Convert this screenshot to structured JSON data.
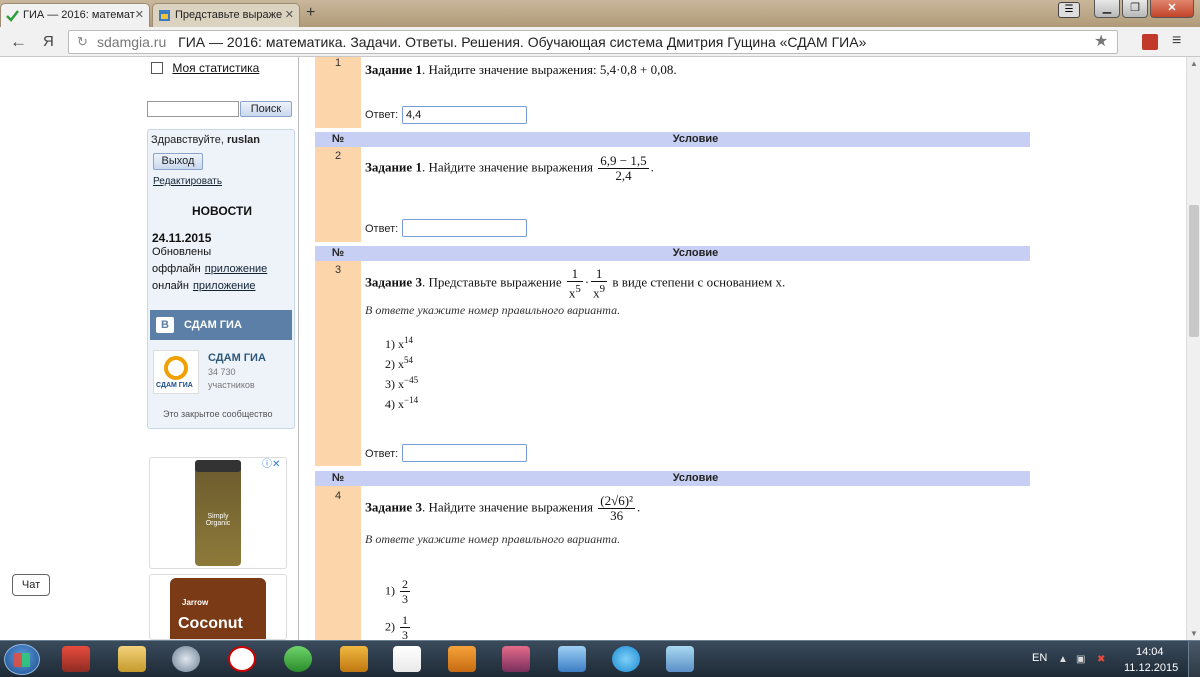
{
  "browser": {
    "tabs": [
      {
        "label": "ГИА — 2016: математ",
        "active": true
      },
      {
        "label": "Представьте выраже",
        "active": false
      }
    ],
    "newtab": "+",
    "back": "←",
    "ya_button": "Я",
    "reload": "↻",
    "domain": "sdamgia.ru",
    "page_title": "ГИА — 2016: математика. Задачи. Ответы. Решения. Обучающая система Дмитрия Гущина «СДАМ ГИА»",
    "star": "★",
    "menu": "≡"
  },
  "sidebar": {
    "stats_link": "Моя статистика",
    "search_button": "Поиск",
    "greeting": "Здравствуйте, ",
    "username": "ruslan",
    "logout_button": "Выход",
    "edit_link": "Редактировать",
    "news_title": "НОВОСТИ",
    "news_date": "24.11.2015",
    "news_line1": "Обновлены",
    "news_line2_prefix": "оффлайн",
    "news_line2_link": "приложение",
    "news_line3_prefix": "онлайн",
    "news_line3_link": "приложение",
    "vk_logo": "В",
    "vk_header": "СДАМ ГИА",
    "vk_group_name": "СДАМ ГИА",
    "vk_group_caption": "СДАМ ГИА",
    "vk_member_count": "34 730",
    "vk_members_label": "участников",
    "vk_closed": "Это закрытое сообщество",
    "ad1_label": "Simply Organic",
    "ad2_brand": "Jarrow",
    "ad2_name": "Coconut",
    "ad_badge": "ⓘ✕",
    "chat_button": "Чат"
  },
  "table": {
    "hdr_no": "№",
    "hdr_cond": "Условие",
    "answer_label": "Ответ:",
    "tasks": [
      {
        "number": "1",
        "title": "Задание 1",
        "text": ". Найдите значение выражения: 5,4·0,8 + 0,08.",
        "answer": "4,4"
      },
      {
        "number": "2",
        "title": "Задание 1",
        "text": ". Найдите значение выражения",
        "frac_num": "6,9 − 1,5",
        "frac_den": "2,4",
        "tail": ".",
        "answer": ""
      },
      {
        "number": "3",
        "title": "Задание 3",
        "text": ". Представьте выражение",
        "f1_num": "1",
        "f1_den_base": "x",
        "f1_den_exp": "5",
        "dot": "·",
        "f2_num": "1",
        "f2_den_base": "x",
        "f2_den_exp": "9",
        "tail": "в виде степени с основанием x.",
        "hint": "В ответе укажите номер правильного варианта.",
        "options": [
          {
            "n": "1)",
            "base": "x",
            "exp": "14"
          },
          {
            "n": "2)",
            "base": "x",
            "exp": "54"
          },
          {
            "n": "3)",
            "base": "x",
            "exp": "−45"
          },
          {
            "n": "4)",
            "base": "x",
            "exp": "−14"
          }
        ],
        "answer": ""
      },
      {
        "number": "4",
        "title": "Задание 3",
        "text": ". Найдите значение выражения",
        "frac_num": "(2√6)²",
        "frac_den": "36",
        "tail": ".",
        "hint": "В ответе укажите номер правильного варианта.",
        "options": [
          {
            "n": "1)",
            "num": "2",
            "den": "3"
          },
          {
            "n": "2)",
            "num": "1",
            "den": "3"
          }
        ]
      }
    ]
  },
  "taskbar": {
    "lang": "EN",
    "time": "14:04",
    "date": "11.12.2015",
    "icons": [
      "explorer-icon",
      "steam-icon",
      "yandex-browser-icon",
      "utorrent-icon",
      "h-app-icon",
      "yandex-icon",
      "media-player-icon",
      "game-icon",
      "volume-icon",
      "skype-icon",
      "paint-icon"
    ]
  }
}
